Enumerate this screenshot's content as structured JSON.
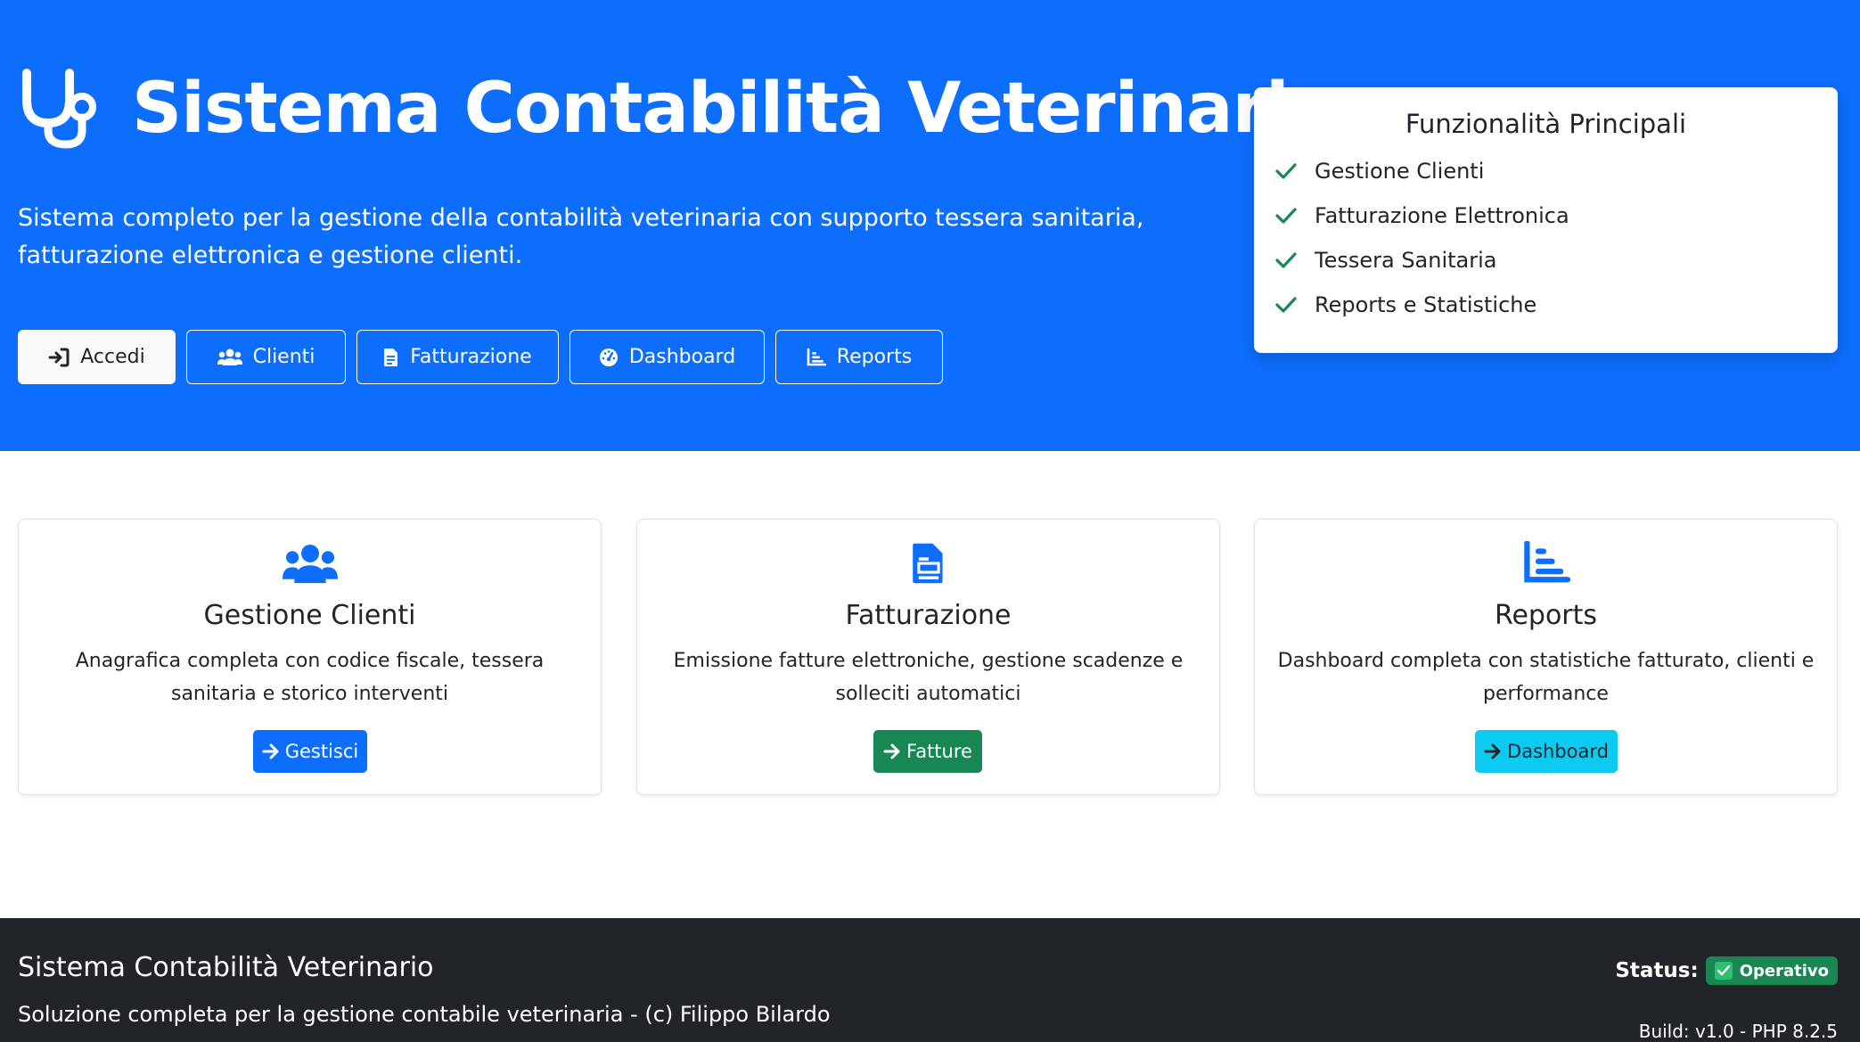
{
  "hero": {
    "title": "Sistema Contabilità Veterinario",
    "description": "Sistema completo per la gestione della contabilità veterinaria con supporto tessera sanitaria, fatturazione elettronica e gestione clienti.",
    "buttons": {
      "accedi": "Accedi",
      "clienti": "Clienti",
      "fatturazione": "Fatturazione",
      "dashboard": "Dashboard",
      "reports": "Reports"
    }
  },
  "features": {
    "title": "Funzionalità Principali",
    "items": [
      "Gestione Clienti",
      "Fatturazione Elettronica",
      "Tessera Sanitaria",
      "Reports e Statistiche"
    ]
  },
  "cards": [
    {
      "title": "Gestione Clienti",
      "text": "Anagrafica completa con codice fiscale, tessera sanitaria e storico interventi",
      "button": "Gestisci",
      "icon": "users-icon",
      "color": "#0d6efd"
    },
    {
      "title": "Fatturazione",
      "text": "Emissione fatture elettroniche, gestione scadenze e solleciti automatici",
      "button": "Fatture",
      "icon": "invoice-icon",
      "color": "#198754"
    },
    {
      "title": "Reports",
      "text": "Dashboard completa con statistiche fatturato, clienti e performance",
      "button": "Dashboard",
      "icon": "chart-icon",
      "color": "#0dcaf0"
    }
  ],
  "footer": {
    "title": "Sistema Contabilità Veterinario",
    "subtitle": "Soluzione completa per la gestione contabile veterinaria - (c) Filippo Bilardo",
    "status_label": "Status:",
    "status_value": "Operativo",
    "build": "Build: v1.0 - PHP 8.2.5"
  },
  "colors": {
    "primary": "#0d6efd",
    "success": "#198754",
    "info": "#0dcaf0",
    "dark": "#212529"
  }
}
